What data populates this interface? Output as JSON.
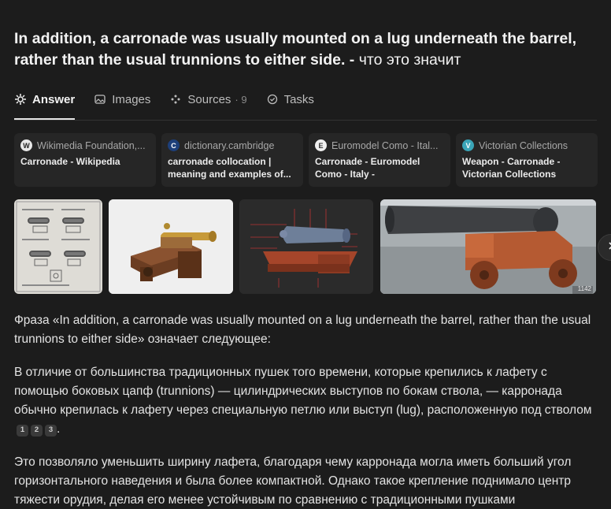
{
  "question": {
    "text_en": "In addition, a carronade was usually mounted on a lug underneath the barrel, rather than the usual trunnions to either side. - ",
    "text_ru": "что это значит"
  },
  "tabs": [
    {
      "label": "Answer",
      "icon": "sparkle-icon",
      "active": true
    },
    {
      "label": "Images",
      "icon": "image-icon"
    },
    {
      "label": "Sources",
      "icon": "sources-icon",
      "count": "· 9"
    },
    {
      "label": "Tasks",
      "icon": "check-circle-icon"
    }
  ],
  "sources": [
    {
      "site": "Wikimedia Foundation,...",
      "title": "Carronade - Wikipedia",
      "favicon": "W"
    },
    {
      "site": "dictionary.cambridge",
      "title": "carronade collocation | meaning and examples of...",
      "favicon": "C"
    },
    {
      "site": "Euromodel Como - Ital...",
      "title": "Carronade - Euromodel Como - Italy -",
      "favicon": "E"
    },
    {
      "site": "Victorian Collections",
      "title": "Weapon - Carronade - Victorian Collections",
      "favicon": "V"
    }
  ],
  "gallery": {
    "images": [
      "carronade-drawings",
      "brass-carronade-model",
      "carronade-diagram",
      "carronade-photo"
    ],
    "photo_badge": "1142"
  },
  "answer": {
    "p1": "Фраза «In addition, a carronade was usually mounted on a lug underneath the barrel, rather than the usual trunnions to either side» означает следующее:",
    "p2": "В отличие от большинства традиционных пушек того времени, которые крепились к лафету с помощью боковых цапф (trunnions) — цилиндрических выступов по бокам ствола, — карронада обычно крепилась к лафету через специальную петлю или выступ (lug), расположенную под стволом",
    "p2_citations": [
      "1",
      "2",
      "3"
    ],
    "p3": "Это позволяло уменьшить ширину лафета, благодаря чему карронада могла иметь больший угол горизонтального наведения и была более компактной. Однако такое крепление поднимало центр тяжести орудия, делая его менее устойчивым по сравнению с традиционными пушками"
  }
}
